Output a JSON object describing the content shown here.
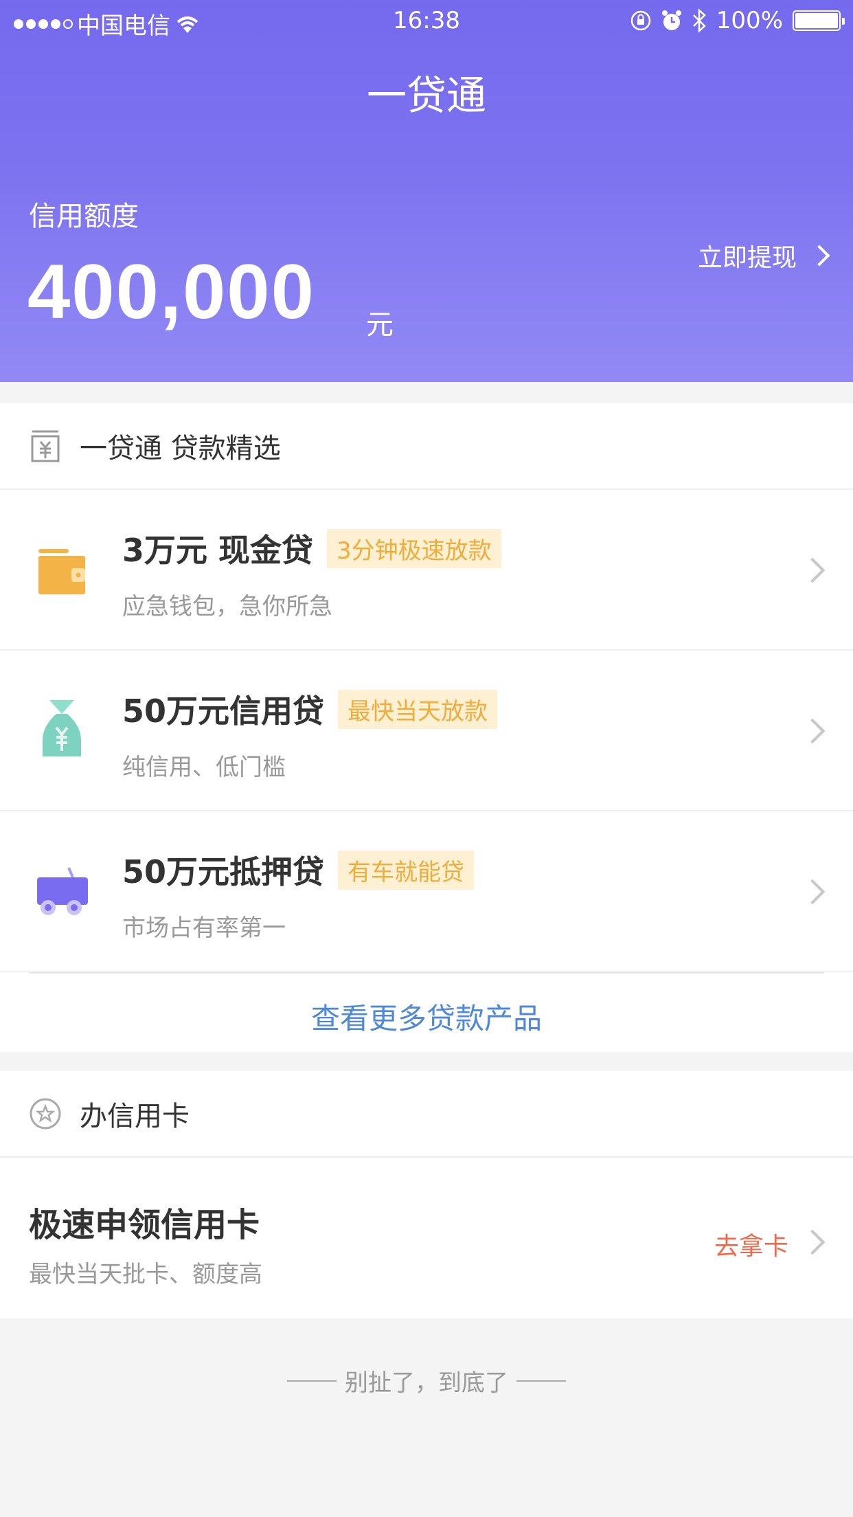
{
  "status_bar": {
    "carrier": "中国电信",
    "signal_filled": 4,
    "signal_total": 5,
    "time": "16:38",
    "battery": "100%"
  },
  "header": {
    "title": "一贷通",
    "credit_label": "信用额度",
    "credit_amount": "400,000",
    "credit_unit": "元",
    "withdraw_label": "立即提现"
  },
  "loans": {
    "section_title": "一贷通 贷款精选",
    "items": [
      {
        "name": "3万元 现金贷",
        "badge": "3分钟极速放款",
        "subtitle": "应急钱包，急你所急",
        "icon": "wallet-icon"
      },
      {
        "name": "50万元信用贷",
        "badge": "最快当天放款",
        "subtitle": "纯信用、低门槛",
        "icon": "money-bag-icon"
      },
      {
        "name": "50万元抵押贷",
        "badge": "有车就能贷",
        "subtitle": "市场占有率第一",
        "icon": "car-icon"
      }
    ],
    "more_link": "查看更多贷款产品"
  },
  "credit_card": {
    "section_title": "办信用卡",
    "title": "极速申领信用卡",
    "subtitle": "最快当天批卡、额度高",
    "action": "去拿卡"
  },
  "footer": {
    "text": "别扯了，到底了"
  },
  "colors": {
    "header_gradient_top": "#7569ee",
    "header_gradient_bottom": "#9289f5",
    "badge_bg": "#fdf0d3",
    "badge_text": "#f0ad3c",
    "link": "#4e88d8",
    "action": "#ee6a4c",
    "wallet": "#f3b347",
    "bag": "#7dd3c0",
    "car": "#7a6cf0"
  }
}
